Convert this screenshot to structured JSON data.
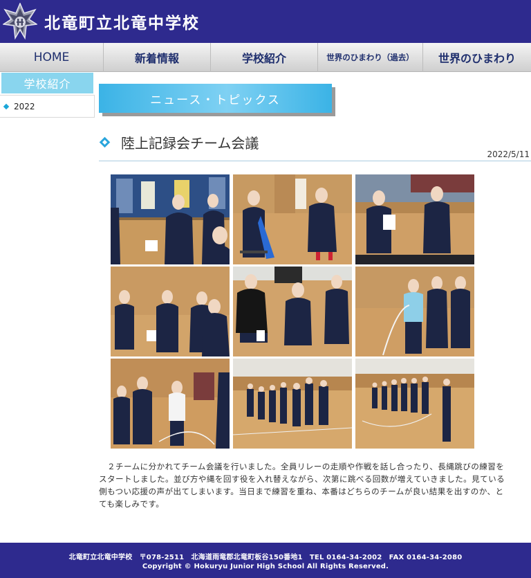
{
  "header": {
    "school_name": "北竜町立北竜中学校"
  },
  "nav": {
    "items": [
      {
        "label": "HOME"
      },
      {
        "label": "新着情報"
      },
      {
        "label": "学校紹介"
      },
      {
        "label": "世界のひまわり（過去）"
      },
      {
        "label": "世界のひまわり"
      }
    ]
  },
  "sidebar": {
    "title": "学校紹介",
    "items": [
      {
        "label": "2022"
      }
    ]
  },
  "banner": {
    "label": "ニュース・トピックス"
  },
  "article": {
    "title": "陸上記録会チーム会議",
    "date": "2022/5/11",
    "body": "２チームに分かれてチーム会議を行いました。全員リレーの走順や作戦を話し合ったり、長縄跳びの練習をスタートしました。並び方や縄を回す役を入れ替えながら、次第に跳べる回数が増えていきました。見ている側もつい応援の声が出てしまいます。当日まで練習を重ね、本番はどちらのチームが良い結果を出すのか、とても楽しみです。",
    "photos": [
      {
        "name": "photo-students-seated-1"
      },
      {
        "name": "photo-students-seated-2"
      },
      {
        "name": "photo-students-seated-3"
      },
      {
        "name": "photo-students-seated-4"
      },
      {
        "name": "photo-students-seated-5"
      },
      {
        "name": "photo-students-jump-rope-1"
      },
      {
        "name": "photo-students-jump-rope-2"
      },
      {
        "name": "photo-students-jump-rope-3"
      },
      {
        "name": "photo-students-jump-rope-4"
      }
    ]
  },
  "footer": {
    "line1": "北竜町立北竜中学校　〒078-2511　北海道雨竜郡北竜町板谷150番地1　TEL 0164-34-2002　FAX 0164-34-2080",
    "line2": "Copyright © Hokuryu Junior High School All Rights Reserved."
  },
  "colors": {
    "header_bg": "#2e2a8e",
    "accent": "#2aa5dc",
    "banner": "#3bb3e6",
    "sidebar_title": "#89d5ee"
  }
}
